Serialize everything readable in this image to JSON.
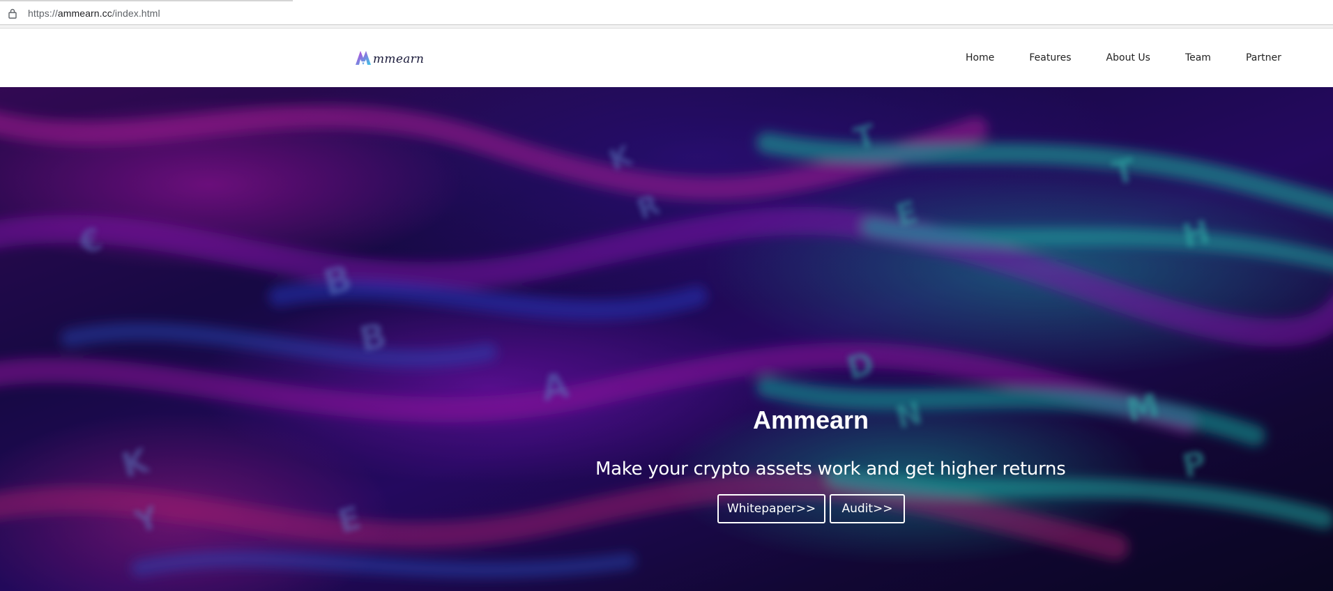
{
  "browser": {
    "url_prefix": "https://",
    "url_host": "ammearn.cc",
    "url_path": "/index.html",
    "lock_icon": "lock-icon"
  },
  "header": {
    "logo_text": "mmearn",
    "logo_icon": "ammearn-logo-icon",
    "nav": [
      {
        "label": "Home"
      },
      {
        "label": "Features"
      },
      {
        "label": "About Us"
      },
      {
        "label": "Team"
      },
      {
        "label": "Partner"
      }
    ]
  },
  "hero": {
    "title": "Ammearn",
    "subtitle": "Make your crypto assets work and get higher returns",
    "buttons": {
      "whitepaper": "Whitepaper>>",
      "audit": "Audit>>"
    }
  },
  "colors": {
    "magenta": "#b01cb8",
    "teal": "#19b3a6",
    "deep_purple": "#1a0a4a",
    "white": "#ffffff"
  }
}
